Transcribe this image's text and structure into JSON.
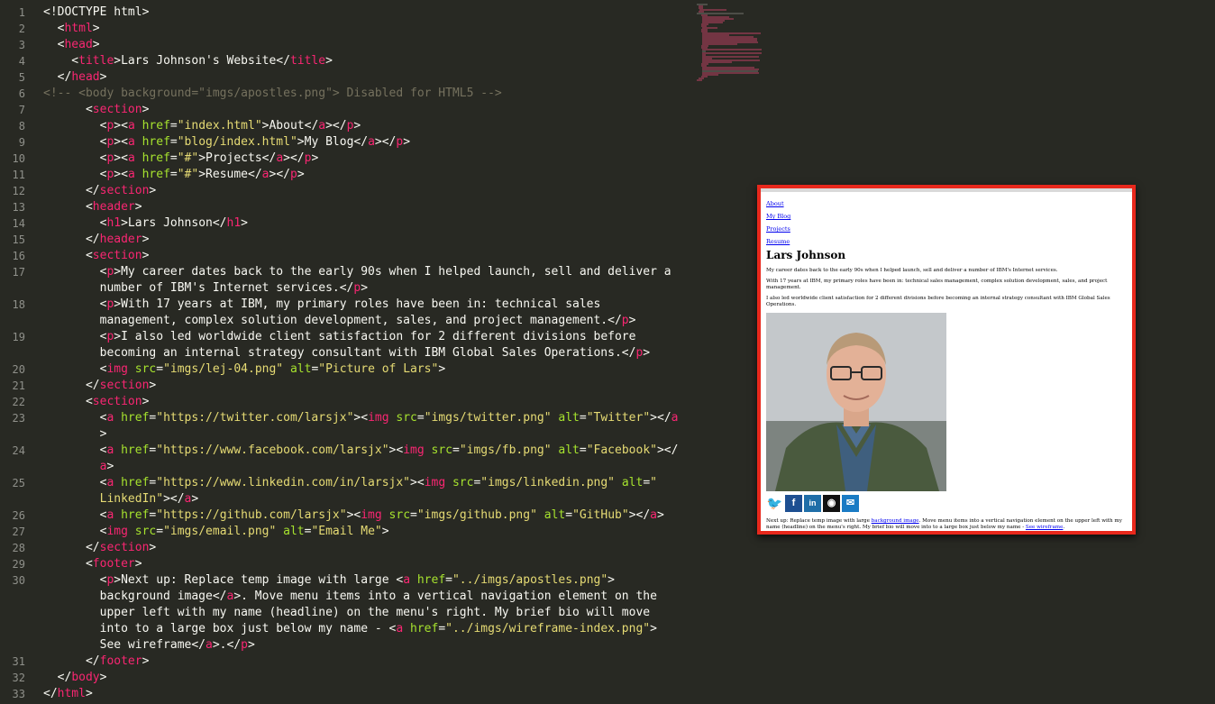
{
  "editor": {
    "line_numbers": [
      "1",
      "2",
      "3",
      "4",
      "5",
      "6",
      "7",
      "8",
      "9",
      "10",
      "11",
      "12",
      "13",
      "14",
      "15",
      "16",
      "17",
      "",
      "18",
      "",
      "19",
      "",
      "20",
      "21",
      "22",
      "23",
      "",
      "24",
      "",
      "25",
      "",
      "26",
      "27",
      "28",
      "29",
      "30",
      "",
      "",
      "",
      "",
      "31",
      "32",
      "33"
    ],
    "lines": [
      [
        [
          "txt",
          "<!DOCTYPE html>"
        ]
      ],
      [
        [
          "txt",
          "  "
        ],
        [
          "txt",
          "<"
        ],
        [
          "tag",
          "html"
        ],
        [
          "txt",
          ">"
        ]
      ],
      [
        [
          "txt",
          "  <"
        ],
        [
          "tag",
          "head"
        ],
        [
          "txt",
          ">"
        ]
      ],
      [
        [
          "txt",
          "    <"
        ],
        [
          "tag",
          "title"
        ],
        [
          "txt",
          ">Lars Johnson's Website</"
        ],
        [
          "tag",
          "title"
        ],
        [
          "txt",
          ">"
        ]
      ],
      [
        [
          "txt",
          "  </"
        ],
        [
          "tag",
          "head"
        ],
        [
          "txt",
          ">"
        ]
      ],
      [
        [
          "cmt",
          "<!-- <body background=\"imgs/apostles.png\"> Disabled for HTML5 -->"
        ]
      ],
      [
        [
          "txt",
          "      <"
        ],
        [
          "tag",
          "section"
        ],
        [
          "txt",
          ">"
        ]
      ],
      [
        [
          "txt",
          "        <"
        ],
        [
          "tag",
          "p"
        ],
        [
          "txt",
          "><"
        ],
        [
          "tag",
          "a"
        ],
        [
          "txt",
          " "
        ],
        [
          "attr",
          "href"
        ],
        [
          "txt",
          "="
        ],
        [
          "str",
          "\"index.html\""
        ],
        [
          "txt",
          ">About</"
        ],
        [
          "tag",
          "a"
        ],
        [
          "txt",
          "></"
        ],
        [
          "tag",
          "p"
        ],
        [
          "txt",
          ">"
        ]
      ],
      [
        [
          "txt",
          "        <"
        ],
        [
          "tag",
          "p"
        ],
        [
          "txt",
          "><"
        ],
        [
          "tag",
          "a"
        ],
        [
          "txt",
          " "
        ],
        [
          "attr",
          "href"
        ],
        [
          "txt",
          "="
        ],
        [
          "str",
          "\"blog/index.html\""
        ],
        [
          "txt",
          ">My Blog</"
        ],
        [
          "tag",
          "a"
        ],
        [
          "txt",
          "></"
        ],
        [
          "tag",
          "p"
        ],
        [
          "txt",
          ">"
        ]
      ],
      [
        [
          "txt",
          "        <"
        ],
        [
          "tag",
          "p"
        ],
        [
          "txt",
          "><"
        ],
        [
          "tag",
          "a"
        ],
        [
          "txt",
          " "
        ],
        [
          "attr",
          "href"
        ],
        [
          "txt",
          "="
        ],
        [
          "str",
          "\"#\""
        ],
        [
          "txt",
          ">Projects</"
        ],
        [
          "tag",
          "a"
        ],
        [
          "txt",
          "></"
        ],
        [
          "tag",
          "p"
        ],
        [
          "txt",
          ">"
        ]
      ],
      [
        [
          "txt",
          "        <"
        ],
        [
          "tag",
          "p"
        ],
        [
          "txt",
          "><"
        ],
        [
          "tag",
          "a"
        ],
        [
          "txt",
          " "
        ],
        [
          "attr",
          "href"
        ],
        [
          "txt",
          "="
        ],
        [
          "str",
          "\"#\""
        ],
        [
          "txt",
          ">Resume</"
        ],
        [
          "tag",
          "a"
        ],
        [
          "txt",
          "></"
        ],
        [
          "tag",
          "p"
        ],
        [
          "txt",
          ">"
        ]
      ],
      [
        [
          "txt",
          "      </"
        ],
        [
          "tag",
          "section"
        ],
        [
          "txt",
          ">"
        ]
      ],
      [
        [
          "txt",
          "      <"
        ],
        [
          "tag",
          "header"
        ],
        [
          "txt",
          ">"
        ]
      ],
      [
        [
          "txt",
          "        <"
        ],
        [
          "tag",
          "h1"
        ],
        [
          "txt",
          ">Lars Johnson</"
        ],
        [
          "tag",
          "h1"
        ],
        [
          "txt",
          ">"
        ]
      ],
      [
        [
          "txt",
          "      </"
        ],
        [
          "tag",
          "header"
        ],
        [
          "txt",
          ">"
        ]
      ],
      [
        [
          "txt",
          "      <"
        ],
        [
          "tag",
          "section"
        ],
        [
          "txt",
          ">"
        ]
      ],
      [
        [
          "txt",
          "        <"
        ],
        [
          "tag",
          "p"
        ],
        [
          "txt",
          ">My career dates back to the early 90s when I helped launch, sell and deliver a"
        ]
      ],
      [
        [
          "txt",
          "        number of IBM's Internet services.</"
        ],
        [
          "tag",
          "p"
        ],
        [
          "txt",
          ">"
        ]
      ],
      [
        [
          "txt",
          "        <"
        ],
        [
          "tag",
          "p"
        ],
        [
          "txt",
          ">With 17 years at IBM, my primary roles have been in: technical sales"
        ]
      ],
      [
        [
          "txt",
          "        management, complex solution development, sales, and project management.</"
        ],
        [
          "tag",
          "p"
        ],
        [
          "txt",
          ">"
        ]
      ],
      [
        [
          "txt",
          "        <"
        ],
        [
          "tag",
          "p"
        ],
        [
          "txt",
          ">I also led worldwide client satisfaction for 2 different divisions before"
        ]
      ],
      [
        [
          "txt",
          "        becoming an internal strategy consultant with IBM Global Sales Operations.</"
        ],
        [
          "tag",
          "p"
        ],
        [
          "txt",
          ">"
        ]
      ],
      [
        [
          "txt",
          "        <"
        ],
        [
          "tag",
          "img"
        ],
        [
          "txt",
          " "
        ],
        [
          "attr",
          "src"
        ],
        [
          "txt",
          "="
        ],
        [
          "str",
          "\"imgs/lej-04.png\""
        ],
        [
          "txt",
          " "
        ],
        [
          "attr",
          "alt"
        ],
        [
          "txt",
          "="
        ],
        [
          "str",
          "\"Picture of Lars\""
        ],
        [
          "txt",
          ">"
        ]
      ],
      [
        [
          "txt",
          "      </"
        ],
        [
          "tag",
          "section"
        ],
        [
          "txt",
          ">"
        ]
      ],
      [
        [
          "txt",
          "      <"
        ],
        [
          "tag",
          "section"
        ],
        [
          "txt",
          ">"
        ]
      ],
      [
        [
          "txt",
          "        <"
        ],
        [
          "tag",
          "a"
        ],
        [
          "txt",
          " "
        ],
        [
          "attr",
          "href"
        ],
        [
          "txt",
          "="
        ],
        [
          "str",
          "\"https://twitter.com/larsjx\""
        ],
        [
          "txt",
          "><"
        ],
        [
          "tag",
          "img"
        ],
        [
          "txt",
          " "
        ],
        [
          "attr",
          "src"
        ],
        [
          "txt",
          "="
        ],
        [
          "str",
          "\"imgs/twitter.png\""
        ],
        [
          "txt",
          " "
        ],
        [
          "attr",
          "alt"
        ],
        [
          "txt",
          "="
        ],
        [
          "str",
          "\"Twitter\""
        ],
        [
          "txt",
          "></"
        ],
        [
          "tag",
          "a"
        ]
      ],
      [
        [
          "txt",
          "        >"
        ]
      ],
      [
        [
          "txt",
          "        <"
        ],
        [
          "tag",
          "a"
        ],
        [
          "txt",
          " "
        ],
        [
          "attr",
          "href"
        ],
        [
          "txt",
          "="
        ],
        [
          "str",
          "\"https://www.facebook.com/larsjx\""
        ],
        [
          "txt",
          "><"
        ],
        [
          "tag",
          "img"
        ],
        [
          "txt",
          " "
        ],
        [
          "attr",
          "src"
        ],
        [
          "txt",
          "="
        ],
        [
          "str",
          "\"imgs/fb.png\""
        ],
        [
          "txt",
          " "
        ],
        [
          "attr",
          "alt"
        ],
        [
          "txt",
          "="
        ],
        [
          "str",
          "\"Facebook\""
        ],
        [
          "txt",
          "></"
        ]
      ],
      [
        [
          "txt",
          "        "
        ],
        [
          "tag",
          "a"
        ],
        [
          "txt",
          ">"
        ]
      ],
      [
        [
          "txt",
          "        <"
        ],
        [
          "tag",
          "a"
        ],
        [
          "txt",
          " "
        ],
        [
          "attr",
          "href"
        ],
        [
          "txt",
          "="
        ],
        [
          "str",
          "\"https://www.linkedin.com/in/larsjx\""
        ],
        [
          "txt",
          "><"
        ],
        [
          "tag",
          "img"
        ],
        [
          "txt",
          " "
        ],
        [
          "attr",
          "src"
        ],
        [
          "txt",
          "="
        ],
        [
          "str",
          "\"imgs/linkedin.png\""
        ],
        [
          "txt",
          " "
        ],
        [
          "attr",
          "alt"
        ],
        [
          "txt",
          "="
        ],
        [
          "str",
          "\""
        ]
      ],
      [
        [
          "str",
          "        LinkedIn\""
        ],
        [
          "txt",
          "></"
        ],
        [
          "tag",
          "a"
        ],
        [
          "txt",
          ">"
        ]
      ],
      [
        [
          "txt",
          "        <"
        ],
        [
          "tag",
          "a"
        ],
        [
          "txt",
          " "
        ],
        [
          "attr",
          "href"
        ],
        [
          "txt",
          "="
        ],
        [
          "str",
          "\"https://github.com/larsjx\""
        ],
        [
          "txt",
          "><"
        ],
        [
          "tag",
          "img"
        ],
        [
          "txt",
          " "
        ],
        [
          "attr",
          "src"
        ],
        [
          "txt",
          "="
        ],
        [
          "str",
          "\"imgs/github.png\""
        ],
        [
          "txt",
          " "
        ],
        [
          "attr",
          "alt"
        ],
        [
          "txt",
          "="
        ],
        [
          "str",
          "\"GitHub\""
        ],
        [
          "txt",
          "></"
        ],
        [
          "tag",
          "a"
        ],
        [
          "txt",
          ">"
        ]
      ],
      [
        [
          "txt",
          "        <"
        ],
        [
          "tag",
          "img"
        ],
        [
          "txt",
          " "
        ],
        [
          "attr",
          "src"
        ],
        [
          "txt",
          "="
        ],
        [
          "str",
          "\"imgs/email.png\""
        ],
        [
          "txt",
          " "
        ],
        [
          "attr",
          "alt"
        ],
        [
          "txt",
          "="
        ],
        [
          "str",
          "\"Email Me\""
        ],
        [
          "txt",
          ">"
        ]
      ],
      [
        [
          "txt",
          "      </"
        ],
        [
          "tag",
          "section"
        ],
        [
          "txt",
          ">"
        ]
      ],
      [
        [
          "txt",
          "      <"
        ],
        [
          "tag",
          "footer"
        ],
        [
          "txt",
          ">"
        ]
      ],
      [
        [
          "txt",
          "        <"
        ],
        [
          "tag",
          "p"
        ],
        [
          "txt",
          ">Next up: Replace temp image with large <"
        ],
        [
          "tag",
          "a"
        ],
        [
          "txt",
          " "
        ],
        [
          "attr",
          "href"
        ],
        [
          "txt",
          "="
        ],
        [
          "str",
          "\"../imgs/apostles.png\""
        ],
        [
          "txt",
          ">"
        ]
      ],
      [
        [
          "txt",
          "        background image</"
        ],
        [
          "tag",
          "a"
        ],
        [
          "txt",
          ">. Move menu items into a vertical navigation element on the"
        ]
      ],
      [
        [
          "txt",
          "        upper left with my name (headline) on the menu's right. My brief bio will move"
        ]
      ],
      [
        [
          "txt",
          "        into to a large box just below my name - <"
        ],
        [
          "tag",
          "a"
        ],
        [
          "txt",
          " "
        ],
        [
          "attr",
          "href"
        ],
        [
          "txt",
          "="
        ],
        [
          "str",
          "\"../imgs/wireframe-index.png\""
        ],
        [
          "txt",
          ">"
        ]
      ],
      [
        [
          "txt",
          "        See wireframe</"
        ],
        [
          "tag",
          "a"
        ],
        [
          "txt",
          ">.</"
        ],
        [
          "tag",
          "p"
        ],
        [
          "txt",
          ">"
        ]
      ],
      [
        [
          "txt",
          "      </"
        ],
        [
          "tag",
          "footer"
        ],
        [
          "txt",
          ">"
        ]
      ],
      [
        [
          "txt",
          "  </"
        ],
        [
          "tag",
          "body"
        ],
        [
          "txt",
          ">"
        ]
      ],
      [
        [
          "txt",
          "</"
        ],
        [
          "tag",
          "html"
        ],
        [
          "txt",
          ">"
        ]
      ]
    ]
  },
  "preview": {
    "nav": [
      "About",
      "My Blog",
      "Projects",
      "Resume"
    ],
    "heading": "Lars Johnson",
    "paragraphs": [
      "My career dates back to the early 90s when I helped launch, sell and deliver a number of IBM's Internet services.",
      "With 17 years at IBM, my primary roles have been in: technical sales management, complex solution development, sales, and project management.",
      "I also led worldwide client satisfaction for 2 different divisions before becoming an internal strategy consultant with IBM Global Sales Operations."
    ],
    "footer_text_1": "Next up: Replace temp image with large ",
    "footer_link_1": "background image",
    "footer_text_2": ". Move menu items into a vertical navigation element on the upper left with my name (headline) on the menu's right. My brief bio will move into to a large box just below my name - ",
    "footer_link_2": "See wireframe",
    "footer_text_3": ".",
    "social_icons": [
      "twitter-icon",
      "facebook-icon",
      "linkedin-icon",
      "github-icon",
      "email-icon"
    ],
    "border_color": "#e8281c"
  },
  "colors": {
    "editor_bg": "#282923",
    "tag": "#f92672",
    "attr": "#a6e22e",
    "string": "#e6db74",
    "comment": "#75715e"
  }
}
